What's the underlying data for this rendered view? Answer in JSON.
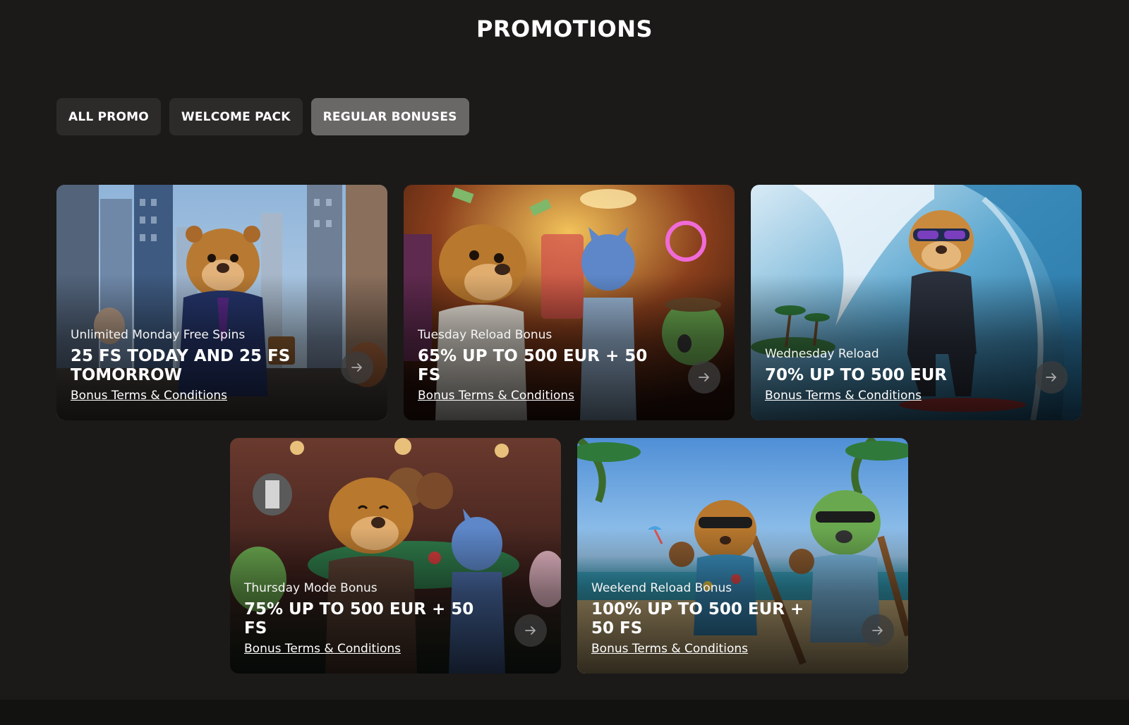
{
  "page": {
    "title": "PROMOTIONS"
  },
  "tabs": [
    {
      "label": "ALL PROMO",
      "active": false
    },
    {
      "label": "WELCOME PACK",
      "active": false
    },
    {
      "label": "REGULAR BONUSES",
      "active": true
    }
  ],
  "cards": [
    {
      "subtitle": "Unlimited Monday Free Spins",
      "headline": "25 FS TODAY AND 25 FS TOMORROW",
      "terms": "Bonus Terms & Conditions",
      "scene": "city"
    },
    {
      "subtitle": "Tuesday Reload Bonus",
      "headline": "65% UP TO 500 EUR + 50 FS",
      "terms": "Bonus Terms & Conditions",
      "scene": "casino"
    },
    {
      "subtitle": "Wednesday Reload",
      "headline": "70% UP TO 500 EUR",
      "terms": "Bonus Terms & Conditions",
      "scene": "surf"
    },
    {
      "subtitle": "Thursday Mode Bonus",
      "headline": "75% UP TO 500 EUR + 50 FS",
      "terms": "Bonus Terms & Conditions",
      "scene": "poker"
    },
    {
      "subtitle": "Weekend Reload Bonus",
      "headline": "100% UP TO 500 EUR + 50 FS",
      "terms": "Bonus Terms & Conditions",
      "scene": "beach"
    }
  ],
  "icons": {
    "card_arrow": "arrow-right-icon"
  },
  "colors": {
    "background": "#1b1a19",
    "tab": "#2c2b2a",
    "tab_active": "#6a6867"
  }
}
